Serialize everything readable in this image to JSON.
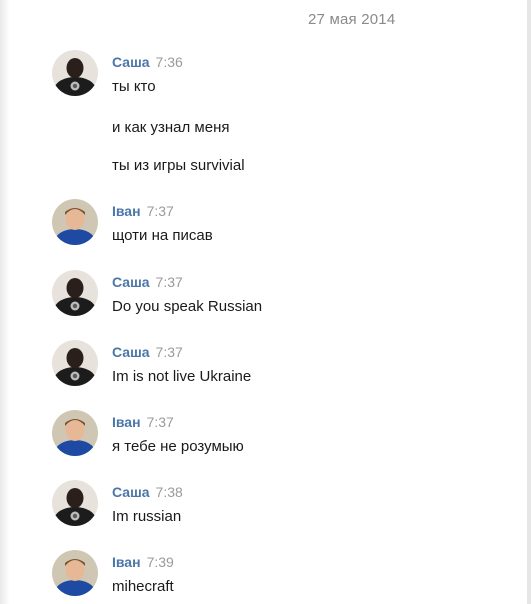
{
  "date_separator": "27 мая 2014",
  "messages": [
    {
      "author": "Саша",
      "time": "7:36",
      "lines": [
        "ты кто",
        "и как узнал меня",
        "ты из игры survivial"
      ]
    },
    {
      "author": "Іван",
      "time": "7:37",
      "lines": [
        "щоти на писав"
      ]
    },
    {
      "author": "Саша",
      "time": "7:37",
      "lines": [
        "Do you speak Russian"
      ]
    },
    {
      "author": "Саша",
      "time": "7:37",
      "lines": [
        "Im is not live Ukraine"
      ]
    },
    {
      "author": "Іван",
      "time": "7:37",
      "lines": [
        "я тебе не розумыю"
      ]
    },
    {
      "author": "Саша",
      "time": "7:38",
      "lines": [
        "Im russian"
      ]
    },
    {
      "author": "Іван",
      "time": "7:39",
      "lines": [
        "mihecraft"
      ]
    }
  ],
  "colors": {
    "author_link": "#4a76a8",
    "timestamp": "#9a9a9a",
    "message_text": "#1a1a1a",
    "date_separator": "#8a8a8a"
  }
}
